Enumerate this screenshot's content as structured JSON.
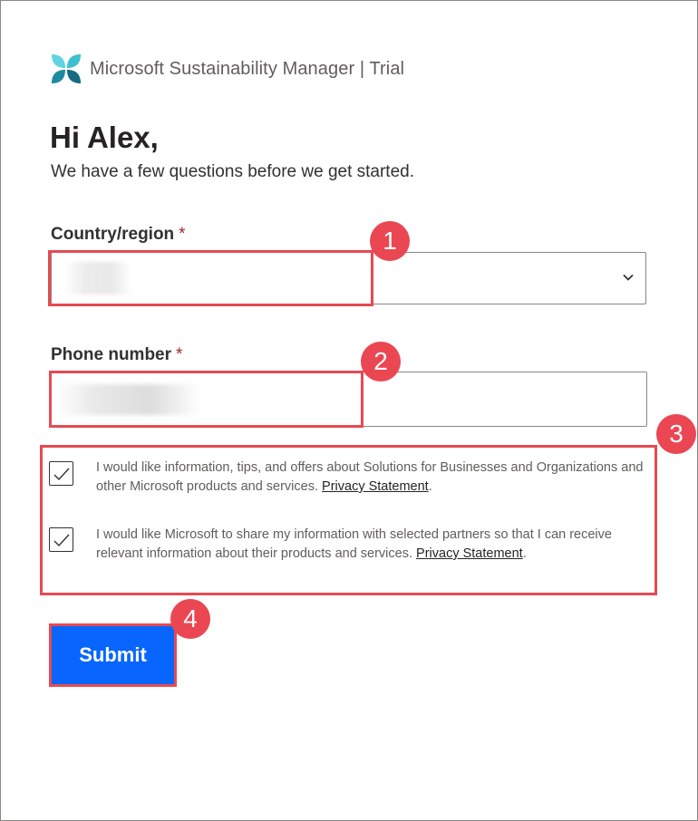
{
  "header": {
    "app_title": "Microsoft Sustainability Manager | Trial",
    "logo_icon": "sustainability-logo-icon"
  },
  "greeting": "Hi Alex,",
  "subtitle": "We have a few questions before we get started.",
  "fields": {
    "country": {
      "label": "Country/region",
      "required_mark": "*",
      "value": ""
    },
    "phone": {
      "label": "Phone number",
      "required_mark": "*",
      "value": ""
    }
  },
  "consents": [
    {
      "checked": true,
      "text": "I would like information, tips, and offers about Solutions for Businesses and Organizations and other Microsoft products and services.",
      "link": "Privacy Statement",
      "suffix": "."
    },
    {
      "checked": true,
      "text": "I would like Microsoft to share my information with selected partners so that I can receive relevant information about their products and services.",
      "link": "Privacy Statement",
      "suffix": "."
    }
  ],
  "submit_label": "Submit",
  "callouts": [
    "1",
    "2",
    "3",
    "4"
  ],
  "colors": {
    "accent": "#0866ff",
    "required": "#a4262c",
    "callout": "#ea4752"
  }
}
